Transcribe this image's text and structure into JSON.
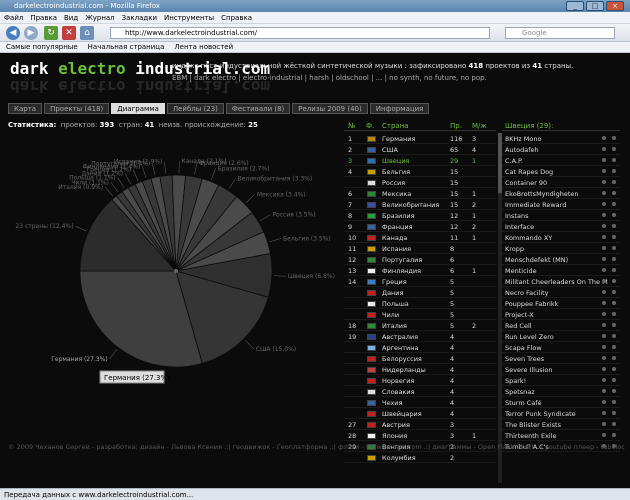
{
  "window": {
    "title": "darkelectroindustrial.com - Mozilla Firefox"
  },
  "menu": [
    "Файл",
    "Правка",
    "Вид",
    "Журнал",
    "Закладки",
    "Инструменты",
    "Справка"
  ],
  "nav": {
    "url": "http://www.darkelectroindustrial.com/",
    "search_placeholder": "Google"
  },
  "bookmarks": [
    "Самые популярные",
    "Начальная страница",
    "Лента новостей"
  ],
  "site": {
    "logo_dark": "dark ",
    "logo_electro": "electro",
    "logo_rest": " industrial.com",
    "logo_mirror": "dark electro industrial.com",
    "desc_1": "индекс пост-индустриальной жёсткой синтетической музыки : зафиксировано ",
    "desc_projects": "418",
    "desc_2": " проектов из ",
    "desc_countries": "41",
    "desc_3": " страны.",
    "tags": "EBM | dark electro | electro-industrial | harsh | oldschool | ... | no synth, no future, no pop."
  },
  "tabs": [
    "Карта",
    "Проекты (418)",
    "Диаграмма",
    "Лейблы (23)",
    "Фестивали (8)",
    "Релизы 2009 (40)",
    "Информация"
  ],
  "active_tab": 2,
  "stats": {
    "label": "Статистика:",
    "projects_label": "проектов:",
    "projects": "393",
    "countries_label": "стран:",
    "countries": "41",
    "unknown_label": "неизв. происхождение:",
    "unknown": "25"
  },
  "chart_data": {
    "type": "pie",
    "tooltip": "Германия (27.3%)",
    "slices": [
      {
        "label": "Германия (27.3%)",
        "value": 27.3,
        "color": "#3f3f3f"
      },
      {
        "label": "23 страны (12.4%)",
        "value": 12.4,
        "color": "#2c2c2c"
      },
      {
        "label": "Италия (0.9%)",
        "value": 0.9,
        "color": "#4a4a4a"
      },
      {
        "label": "Чили (1.1%)",
        "value": 1.1,
        "color": "#383838"
      },
      {
        "label": "Польша (1.1%)",
        "value": 1.1,
        "color": "#4a4a4a"
      },
      {
        "label": "Дания (1.2%)",
        "value": 1.2,
        "color": "#383838"
      },
      {
        "label": "Греция (1.2%)",
        "value": 1.2,
        "color": "#4a4a4a"
      },
      {
        "label": "Финляндия (1.4%)",
        "value": 1.4,
        "color": "#383838"
      },
      {
        "label": "Португалия (1.4%)",
        "value": 1.4,
        "color": "#4a4a4a"
      },
      {
        "label": "Испания (1.9%)",
        "value": 1.9,
        "color": "#383838"
      },
      {
        "label": "Канада (2.1%)",
        "value": 2.1,
        "color": "#4a4a4a"
      },
      {
        "label": "Франция (2.6%)",
        "value": 2.6,
        "color": "#383838"
      },
      {
        "label": "Бразилия (2.7%)",
        "value": 2.7,
        "color": "#4a4a4a"
      },
      {
        "label": "Великобритания (3.3%)",
        "value": 3.3,
        "color": "#383838"
      },
      {
        "label": "Мексика (3.4%)",
        "value": 3.4,
        "color": "#4a4a4a"
      },
      {
        "label": "Россия (3.5%)",
        "value": 3.5,
        "color": "#383838"
      },
      {
        "label": "Бельгия (3.5%)",
        "value": 3.5,
        "color": "#4a4a4a"
      },
      {
        "label": "Швеция (6.8%)",
        "value": 6.8,
        "color": "#2f2f2f"
      },
      {
        "label": "США (15.0%)",
        "value": 15.0,
        "color": "#353535"
      }
    ]
  },
  "table": {
    "headers": [
      "№",
      "Ф.",
      "Страна",
      "Пр.",
      "М/ж"
    ],
    "selected": 2,
    "rows": [
      {
        "rank": "1",
        "country": "Германия",
        "proj": "116",
        "mf": "3",
        "flag": "#b8860b"
      },
      {
        "rank": "2",
        "country": "США",
        "proj": "65",
        "mf": "4",
        "flag": "#3a5fa0"
      },
      {
        "rank": "3",
        "country": "Швеция",
        "proj": "29",
        "mf": "1",
        "flag": "#2a6fb0"
      },
      {
        "rank": "4",
        "country": "Бельгия",
        "proj": "15",
        "mf": "",
        "flag": "#c8a000"
      },
      {
        "rank": "",
        "country": "Россия",
        "proj": "15",
        "mf": "",
        "flag": "#ddd"
      },
      {
        "rank": "6",
        "country": "Мексика",
        "proj": "15",
        "mf": "1",
        "flag": "#2a8a3a"
      },
      {
        "rank": "7",
        "country": "Великобритания",
        "proj": "15",
        "mf": "2",
        "flag": "#3a4fa0"
      },
      {
        "rank": "8",
        "country": "Бразилия",
        "proj": "12",
        "mf": "1",
        "flag": "#2a9a3a"
      },
      {
        "rank": "9",
        "country": "Франция",
        "proj": "12",
        "mf": "2",
        "flag": "#3a5fa0"
      },
      {
        "rank": "10",
        "country": "Канада",
        "proj": "11",
        "mf": "1",
        "flag": "#c02020"
      },
      {
        "rank": "11",
        "country": "Испания",
        "proj": "8",
        "mf": "",
        "flag": "#c8a000"
      },
      {
        "rank": "12",
        "country": "Португалия",
        "proj": "6",
        "mf": "",
        "flag": "#2a8a3a"
      },
      {
        "rank": "13",
        "country": "Финляндия",
        "proj": "6",
        "mf": "1",
        "flag": "#eee"
      },
      {
        "rank": "14",
        "country": "Греция",
        "proj": "5",
        "mf": "",
        "flag": "#3a7fc0"
      },
      {
        "rank": "",
        "country": "Дания",
        "proj": "5",
        "mf": "",
        "flag": "#c02020"
      },
      {
        "rank": "",
        "country": "Польша",
        "proj": "5",
        "mf": "",
        "flag": "#eee"
      },
      {
        "rank": "",
        "country": "Чили",
        "proj": "5",
        "mf": "",
        "flag": "#c02020"
      },
      {
        "rank": "18",
        "country": "Италия",
        "proj": "5",
        "mf": "2",
        "flag": "#2a8a3a"
      },
      {
        "rank": "19",
        "country": "Австралия",
        "proj": "4",
        "mf": "",
        "flag": "#2a3f8a"
      },
      {
        "rank": "",
        "country": "Аргентина",
        "proj": "4",
        "mf": "",
        "flag": "#7ab0e0"
      },
      {
        "rank": "",
        "country": "Белоруссия",
        "proj": "4",
        "mf": "",
        "flag": "#c02020"
      },
      {
        "rank": "",
        "country": "Нидерланды",
        "proj": "4",
        "mf": "",
        "flag": "#c04040"
      },
      {
        "rank": "",
        "country": "Норвегия",
        "proj": "4",
        "mf": "",
        "flag": "#c02020"
      },
      {
        "rank": "",
        "country": "Словакия",
        "proj": "4",
        "mf": "",
        "flag": "#ddd"
      },
      {
        "rank": "",
        "country": "Чехия",
        "proj": "4",
        "mf": "",
        "flag": "#3a5fa0"
      },
      {
        "rank": "",
        "country": "Швейцария",
        "proj": "4",
        "mf": "",
        "flag": "#c02020"
      },
      {
        "rank": "27",
        "country": "Австрия",
        "proj": "3",
        "mf": "",
        "flag": "#c02020"
      },
      {
        "rank": "28",
        "country": "Япония",
        "proj": "3",
        "mf": "1",
        "flag": "#eee"
      },
      {
        "rank": "29",
        "country": "Венгрия",
        "proj": "2",
        "mf": "",
        "flag": "#2a8a3a"
      },
      {
        "rank": "",
        "country": "Колумбия",
        "proj": "2",
        "mf": "",
        "flag": "#c8a000"
      }
    ]
  },
  "bands": {
    "header": "Швеция (29):",
    "items": [
      "8KHz Mono",
      "Autodafeh",
      "C.A.P.",
      "Cat Rapes Dog",
      "Container 90",
      "EkoBrottsMyndigheten",
      "Immediate Reward",
      "Instans",
      "Interface",
      "Kommando XY",
      "Kropp",
      "Menschdefekt (MN)",
      "Menticide",
      "Militant Cheerleaders On The M",
      "Necro Facility",
      "Pouppee Fabrikk",
      "Project-X",
      "Red Cell",
      "Run Level Zero",
      "Scapa Flow",
      "Seven Trees",
      "Severe Illusion",
      "Spark!",
      "Spetsnaz",
      "Sturm Café",
      "Terror Punk Syndicate",
      "The Blister Exists",
      "Thirteenth Exile",
      "Turnbull A.C's"
    ]
  },
  "footer": "© 2009  Чеханов Сергей - разработка; дизайн - Львова Ксения       .:| геодвижок - Геоплатформа  .:| флаги - www.jacorre.com  .:| диаграммы - Open Flash Chart  .:| youtube плеер - tubeloc",
  "status": "Передача данных с www.darkelectroindustrial.com..."
}
